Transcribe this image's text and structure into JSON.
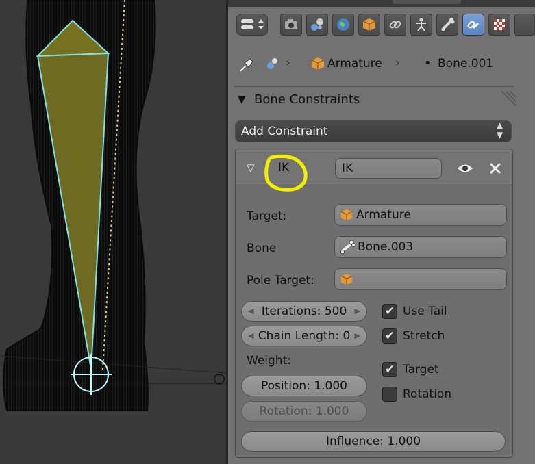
{
  "breadcrumb": {
    "object_name": "Armature",
    "bone_name": "Bone.001"
  },
  "panel_title": "Bone Constraints",
  "add_constraint_label": "Add Constraint",
  "constraint": {
    "type_label": "IK",
    "name_value": "IK",
    "target_label": "Target:",
    "target_value": "Armature",
    "bone_label": "Bone",
    "bone_value": "Bone.003",
    "pole_target_label": "Pole Target:",
    "pole_target_value": "",
    "iterations_label": "Iterations: 500",
    "chain_length_label": "Chain Length: 0",
    "use_tail_label": "Use Tail",
    "use_tail_checked": true,
    "stretch_label": "Stretch",
    "stretch_checked": true,
    "weight_label": "Weight:",
    "weight_position_label": "Position: 1.000",
    "weight_rotation_label": "Rotation: 1.000",
    "target_check_label": "Target",
    "target_checked": true,
    "rotation_check_label": "Rotation",
    "rotation_checked": false,
    "influence_label": "Influence: 1.000"
  },
  "colors": {
    "panel_bg": "#727272",
    "active_tab": "#5a82c0",
    "bone_fill": "#77701e",
    "bone_outline": "#7fe3e3",
    "highlight_circle": "#f2ee00"
  },
  "icons": [
    "display-mode-icon",
    "render-icon",
    "render-layers-icon",
    "world-icon",
    "object-icon",
    "constraints-icon",
    "data-armature-icon",
    "bone-icon",
    "bone-constraint-icon",
    "texture-icon",
    "pin-icon",
    "armature-data-icon",
    "object-cube-icon",
    "eye-icon",
    "close-icon",
    "checkmark-icon"
  ]
}
